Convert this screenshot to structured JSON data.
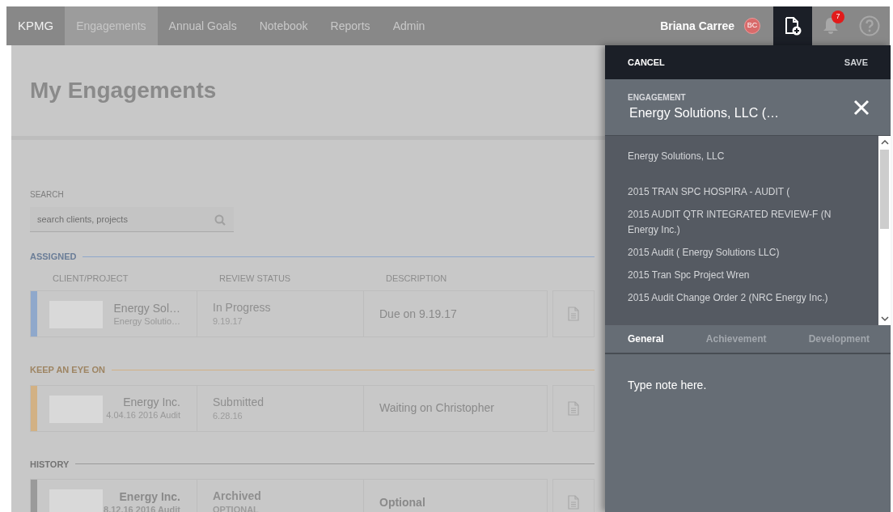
{
  "nav": {
    "brand": "KPMG",
    "tabs": [
      {
        "label": "Engagements",
        "selected": true
      },
      {
        "label": "Annual Goals",
        "selected": false
      },
      {
        "label": "Notebook",
        "selected": false
      },
      {
        "label": "Reports",
        "selected": false
      },
      {
        "label": "Admin",
        "selected": false
      }
    ],
    "user_name": "Briana Carree",
    "avatar": "BC",
    "notification_count": "7"
  },
  "page_title": "My Engagements",
  "search": {
    "label": "SEARCH",
    "placeholder": "search clients, projects"
  },
  "columns": [
    "CLIENT/PROJECT",
    "REVIEW STATUS",
    "DESCRIPTION"
  ],
  "sections": [
    {
      "title": "ASSIGNED",
      "color": "#8fa8cb",
      "rows": [
        {
          "client": "Energy Sol…",
          "project": "Energy Solutio…",
          "status": "In Progress",
          "status_sub": "9.19.17",
          "description": "Due on 9.19.17",
          "bold": false
        }
      ]
    },
    {
      "title": "KEEP AN EYE ON",
      "color": "#d2b184",
      "rows": [
        {
          "client": "Energy Inc.",
          "project": "4.04.16 2016 Audit",
          "status": "Submitted",
          "status_sub": "6.28.16",
          "description": "Waiting on Christopher",
          "bold": false
        }
      ]
    },
    {
      "title": "HISTORY",
      "color": "#9a9a9a",
      "rows": [
        {
          "client": "Energy Inc.",
          "project": "8.12.16 2016 Audit",
          "status": "Archived",
          "status_sub": "OPTIONAL",
          "description": "Optional",
          "bold": true
        }
      ]
    }
  ],
  "panel": {
    "cancel": "CANCEL",
    "save": "SAVE",
    "field_label": "ENGAGEMENT",
    "field_value": "Energy Solutions, LLC (…",
    "options": [
      "Energy Solutions, LLC",
      "2015 TRAN SPC HOSPIRA - AUDIT (",
      "2015 AUDIT QTR INTEGRATED REVIEW-F (N Energy Inc.)",
      "2015 Audit ( Energy Solutions LLC)",
      "2015 Tran Spc Project Wren",
      "2015 Audit Change Order 2 (NRC Energy Inc.)"
    ],
    "tabs": [
      {
        "label": "General",
        "selected": true
      },
      {
        "label": "Achievement",
        "selected": false
      },
      {
        "label": "Development",
        "selected": false
      }
    ],
    "note_placeholder": "Type note here."
  }
}
